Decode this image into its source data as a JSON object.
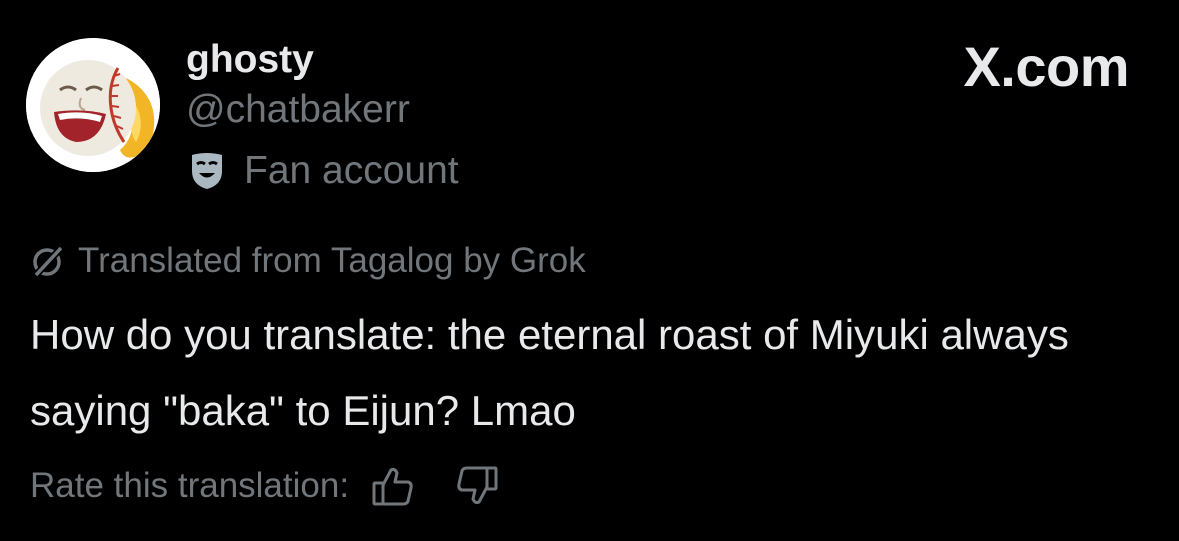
{
  "author": {
    "display_name": "ghosty",
    "handle": "@chatbakerr",
    "label": "Fan account",
    "label_icon": "theater-mask-icon",
    "avatar": "baseball-face-avatar"
  },
  "brand": {
    "text": "X.com"
  },
  "translation": {
    "icon": "grok-icon",
    "label": "Translated from Tagalog by Grok"
  },
  "post": {
    "text": "How do you translate: the eternal roast of Miyuki always saying \"baka\" to Eijun? Lmao"
  },
  "rating": {
    "prompt": "Rate this translation:",
    "thumbs_up_icon": "thumbs-up-icon",
    "thumbs_down_icon": "thumbs-down-icon"
  },
  "colors": {
    "background": "#000000",
    "primary_text": "#e7e9ea",
    "secondary_text": "#71767b"
  }
}
